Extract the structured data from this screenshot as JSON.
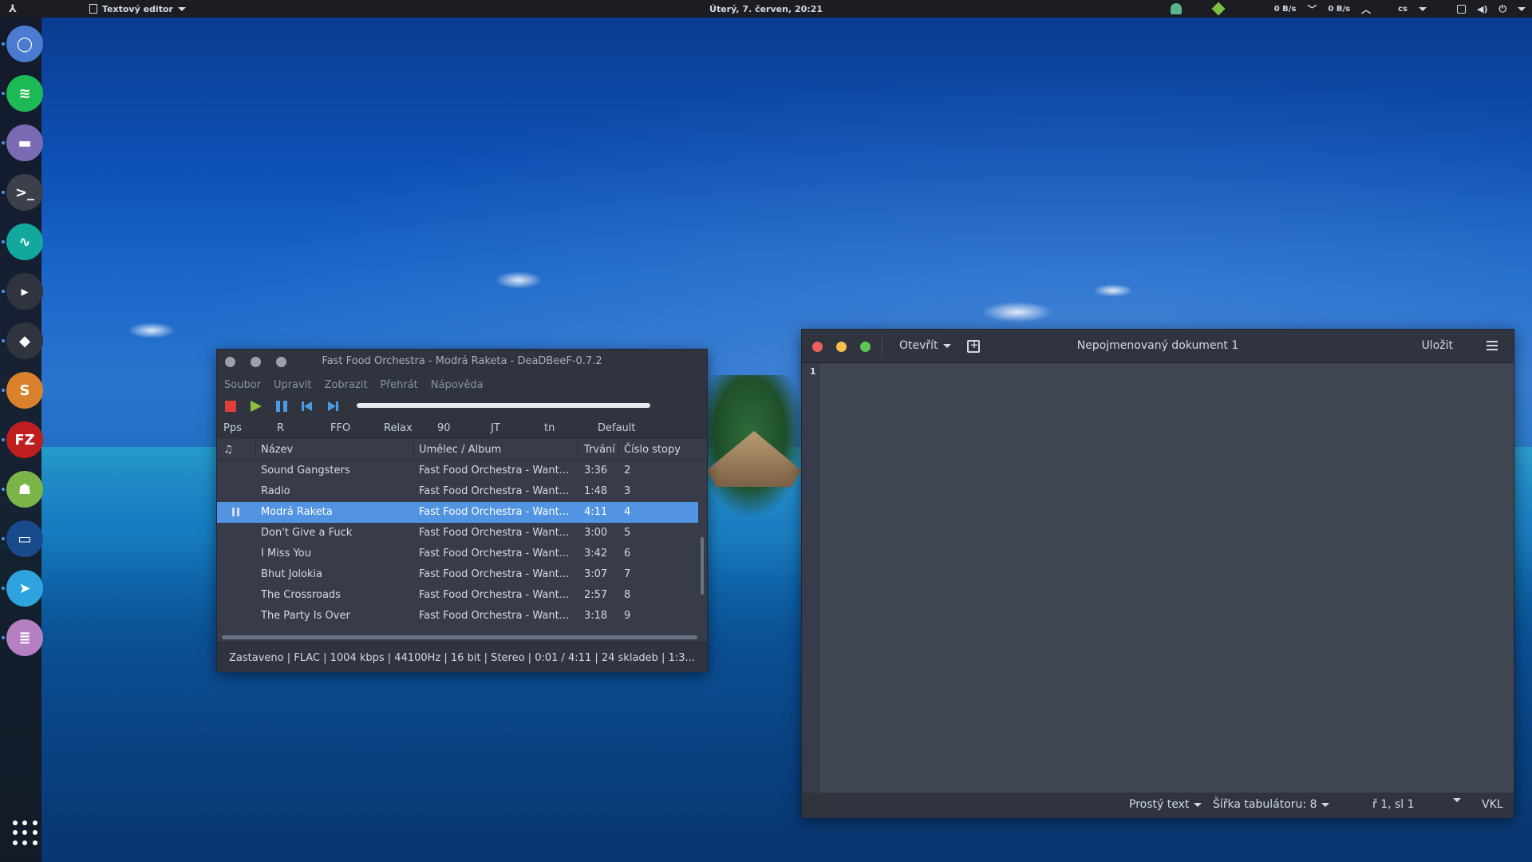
{
  "topbar": {
    "activities_glyph": "⅄",
    "app_menu_label": "Textový editor",
    "clock": "Úterý, 7. červen, 20:21",
    "net_down": "0 B/s",
    "net_up": "0 B/s",
    "keyboard_layout": "cs"
  },
  "dock": {
    "items": [
      {
        "name": "chromium",
        "glyph": "◯",
        "color": "#4a7bd0"
      },
      {
        "name": "spotify",
        "glyph": "≋",
        "color": "#1db954"
      },
      {
        "name": "files",
        "glyph": "▬",
        "color": "#7b6bb5"
      },
      {
        "name": "terminal",
        "glyph": ">_",
        "color": "#3c404a"
      },
      {
        "name": "system-monitor",
        "glyph": "∿",
        "color": "#13a89e"
      },
      {
        "name": "deadbeef",
        "glyph": "▸",
        "color": "#2f343f"
      },
      {
        "name": "kodi",
        "glyph": "◆",
        "color": "#2f343f"
      },
      {
        "name": "sublime",
        "glyph": "S",
        "color": "#d9822b"
      },
      {
        "name": "filezilla",
        "glyph": "FZ",
        "color": "#bf1e1e"
      },
      {
        "name": "android-studio",
        "glyph": "☗",
        "color": "#7bb547"
      },
      {
        "name": "virtualbox",
        "glyph": "▭",
        "color": "#184a8c"
      },
      {
        "name": "telegram",
        "glyph": "➤",
        "color": "#2ea3dd"
      },
      {
        "name": "text-editor",
        "glyph": "≣",
        "color": "#b57fc2"
      }
    ]
  },
  "deadbeef": {
    "title": "Fast Food Orchestra - Modrá Raketa - DeaDBeeF-0.7.2",
    "menu": [
      "Soubor",
      "Upravit",
      "Zobrazit",
      "Přehrát",
      "Nápověda"
    ],
    "playlists": [
      "Pps",
      "R",
      "FFO",
      "Relax",
      "90",
      "JT",
      "tn",
      "Default"
    ],
    "columns": {
      "status": "♫",
      "title": "Název",
      "artist_album": "Umělec / Album",
      "duration": "Trvání",
      "track": "Číslo stopy"
    },
    "rows": [
      {
        "title": "Sound Gangsters",
        "artist": "Fast Food Orchestra - Want...",
        "duration": "3:36",
        "track": "2"
      },
      {
        "title": "Radio",
        "artist": "Fast Food Orchestra - Want...",
        "duration": "1:48",
        "track": "3"
      },
      {
        "title": "Modrá Raketa",
        "artist": "Fast Food Orchestra - Want...",
        "duration": "4:11",
        "track": "4"
      },
      {
        "title": "Don't Give a Fuck",
        "artist": "Fast Food Orchestra - Want...",
        "duration": "3:00",
        "track": "5"
      },
      {
        "title": "I Miss You",
        "artist": "Fast Food Orchestra - Want...",
        "duration": "3:42",
        "track": "6"
      },
      {
        "title": "Bhut Jolokia",
        "artist": "Fast Food Orchestra - Want...",
        "duration": "3:07",
        "track": "7"
      },
      {
        "title": "The Crossroads",
        "artist": "Fast Food Orchestra - Want...",
        "duration": "2:57",
        "track": "8"
      },
      {
        "title": "The Party Is Over",
        "artist": "Fast Food Orchestra - Want...",
        "duration": "3:18",
        "track": "9"
      }
    ],
    "status_bar": "Zastaveno | FLAC | 1004 kbps | 44100Hz | 16 bit | Stereo | 0:01 / 4:11 | 24 skladeb | 1:3..."
  },
  "gedit": {
    "open_label": "Otevřít",
    "title": "Nepojmenovaný dokument 1",
    "save_label": "Uložit",
    "line_number": "1",
    "footer": {
      "language": "Prostý text",
      "tab_width": "Šířka tabulátoru: 8",
      "position": "ř 1, sl 1",
      "insert_mode": "VKL"
    },
    "window_button_colors": [
      "#ec5f5d",
      "#f4bf4f",
      "#61c554"
    ]
  },
  "colors": {
    "selection": "#5294e2",
    "panel": "#2f343f",
    "window_bg": "#383c4a"
  }
}
